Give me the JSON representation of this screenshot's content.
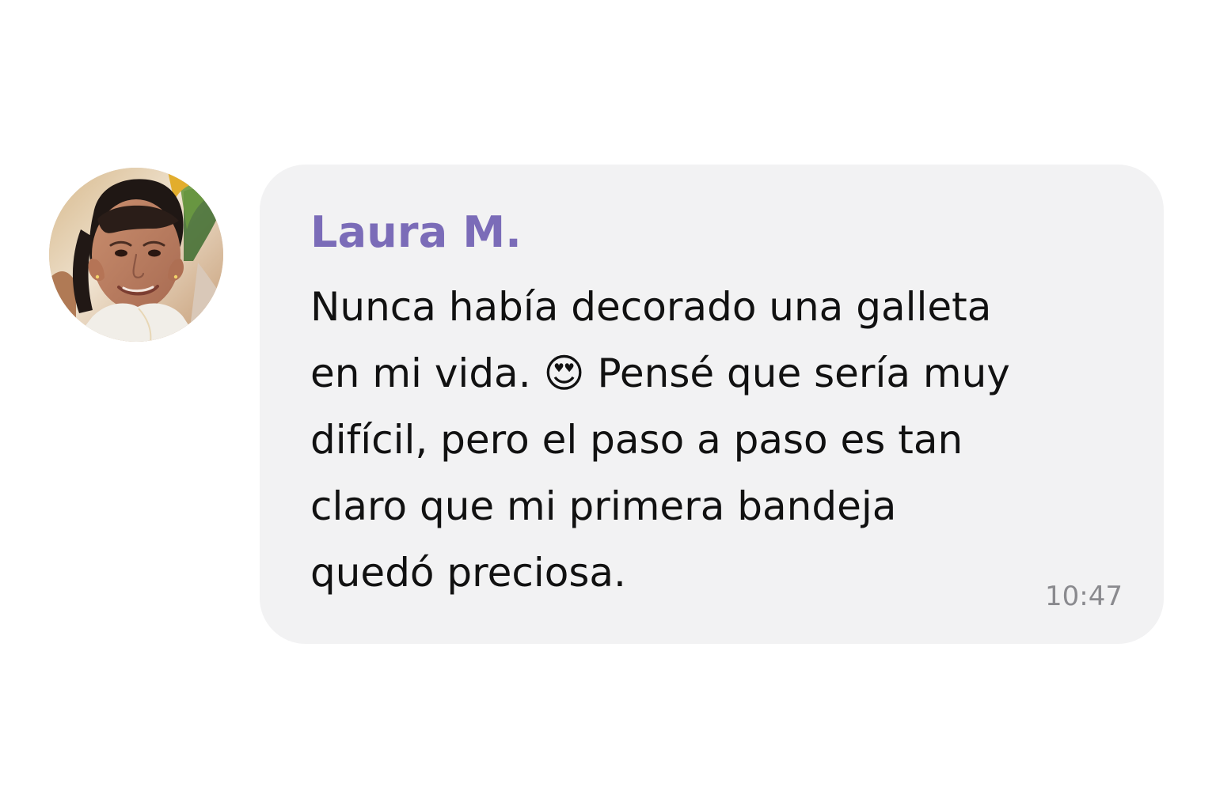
{
  "contact": {
    "avatar_icon": "profile-photo-woman-smiling"
  },
  "message": {
    "sender": "Laura M.",
    "text": "Nunca había decorado una galleta\nen mi vida. 😍 Pensé que sería muy\ndifícil, pero el paso a paso es tan\nclaro que mi primera bandeja\nquedó preciosa.",
    "time": "10:47"
  },
  "colors": {
    "background": "#ffffff",
    "bubble": "#f2f2f3",
    "sender_name": "#7b6cb8",
    "message_text": "#111111",
    "timestamp": "#8a8a8e"
  }
}
